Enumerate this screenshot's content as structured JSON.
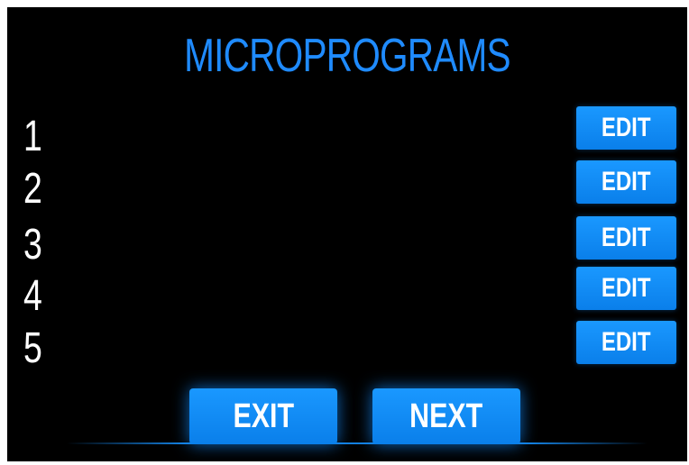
{
  "title": "MICROPROGRAMS",
  "rows": [
    {
      "number": "1",
      "edit_label": "EDIT"
    },
    {
      "number": "2",
      "edit_label": "EDIT"
    },
    {
      "number": "3",
      "edit_label": "EDIT"
    },
    {
      "number": "4",
      "edit_label": "EDIT"
    },
    {
      "number": "5",
      "edit_label": "EDIT"
    }
  ],
  "footer": {
    "exit_label": "EXIT",
    "next_label": "NEXT"
  },
  "colors": {
    "background": "#000000",
    "accent": "#1f8bff",
    "button": "#0a8cf5",
    "text": "#ffffff"
  }
}
